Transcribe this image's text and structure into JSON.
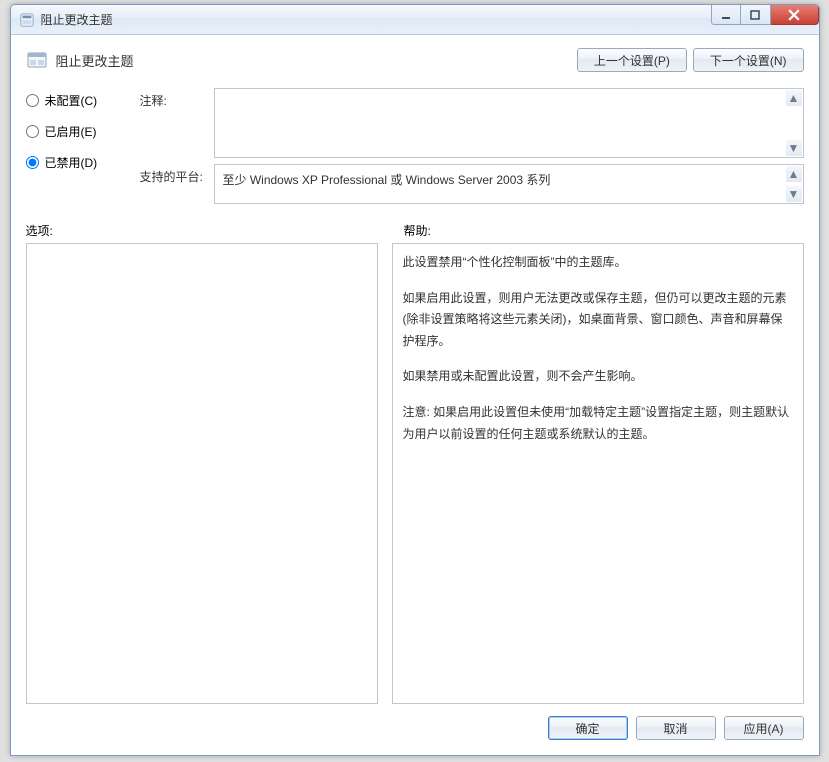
{
  "window": {
    "title": "阻止更改主题"
  },
  "header": {
    "policy_name": "阻止更改主题",
    "prev_button": "上一个设置(P)",
    "next_button": "下一个设置(N)"
  },
  "radios": {
    "not_configured": "未配置(C)",
    "enabled": "已启用(E)",
    "disabled": "已禁用(D)",
    "selected": "disabled"
  },
  "fields": {
    "comment_label": "注释:",
    "comment_value": "",
    "supported_label": "支持的平台:",
    "supported_value": "至少 Windows XP Professional 或 Windows Server 2003 系列"
  },
  "labels": {
    "options": "选项:",
    "help": "帮助:"
  },
  "help": {
    "p1": "此设置禁用“个性化控制面板”中的主题库。",
    "p2": "如果启用此设置，则用户无法更改或保存主题，但仍可以更改主题的元素(除非设置策略将这些元素关闭)，如桌面背景、窗口颜色、声音和屏幕保护程序。",
    "p3": "如果禁用或未配置此设置，则不会产生影响。",
    "p4": "注意: 如果启用此设置但未使用“加载特定主题”设置指定主题，则主题默认为用户以前设置的任何主题或系统默认的主题。"
  },
  "footer": {
    "ok": "确定",
    "cancel": "取消",
    "apply": "应用(A)"
  }
}
